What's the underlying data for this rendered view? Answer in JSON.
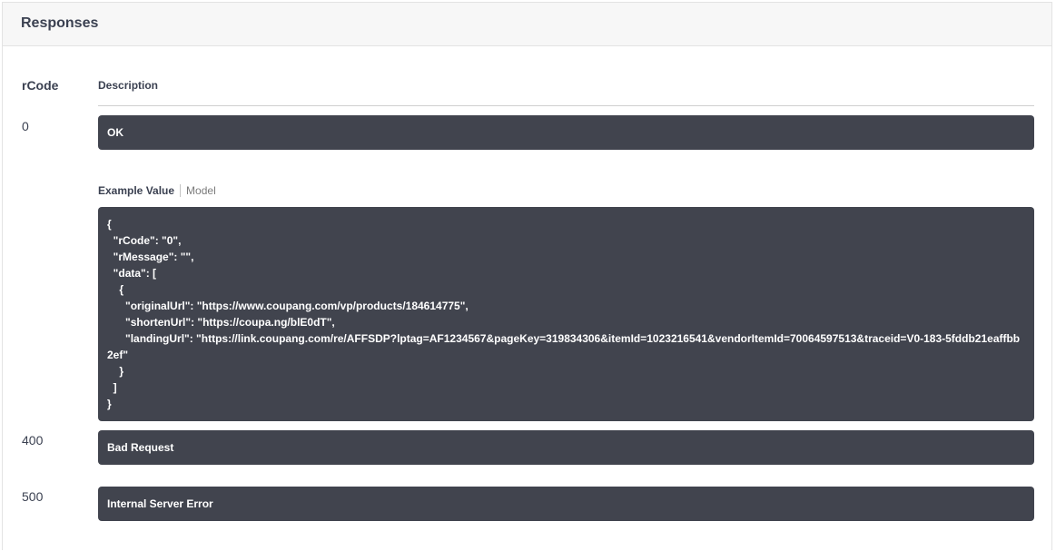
{
  "panel": {
    "title": "Responses"
  },
  "table": {
    "col_code": "rCode",
    "col_desc": "Description"
  },
  "responses": [
    {
      "code": "0",
      "description": "OK"
    },
    {
      "code": "400",
      "description": "Bad Request"
    },
    {
      "code": "500",
      "description": "Internal Server Error"
    }
  ],
  "example": {
    "tab_example": "Example Value",
    "tab_model": "Model",
    "value": "{\n  \"rCode\": \"0\",\n  \"rMessage\": \"\",\n  \"data\": [\n    {\n      \"originalUrl\": \"https://www.coupang.com/vp/products/184614775\",\n      \"shortenUrl\": \"https://coupa.ng/blE0dT\",\n      \"landingUrl\": \"https://link.coupang.com/re/AFFSDP?lptag=AF1234567&pageKey=319834306&itemId=1023216541&vendorItemId=70064597513&traceid=V0-183-5fddb21eaffbb2ef\"\n    }\n  ]\n}"
  }
}
